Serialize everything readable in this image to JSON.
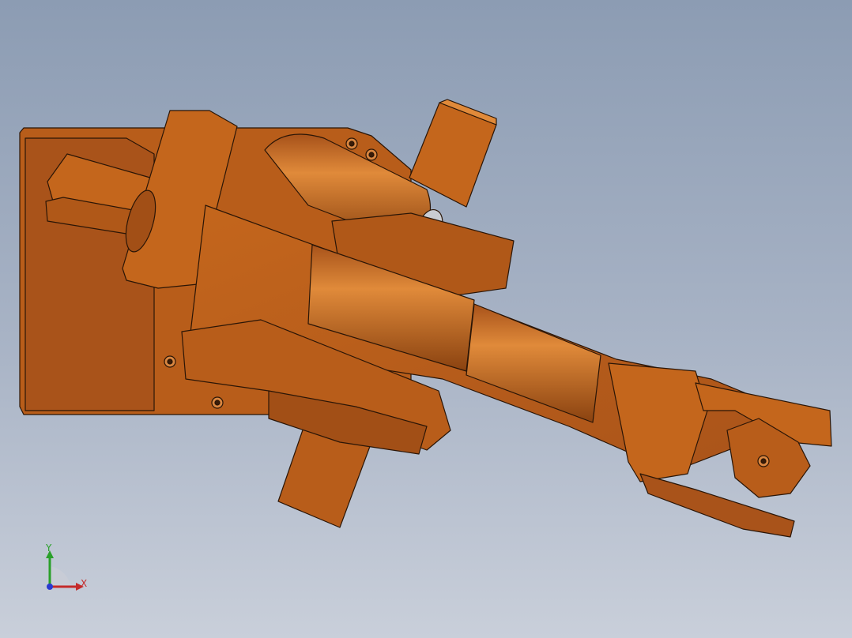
{
  "viewport": {
    "background_top": "#8c9cb3",
    "background_bottom": "#c9cfda"
  },
  "model": {
    "subject": "robot-arm-assembly",
    "body_color": "#c4661c",
    "edge_color": "#2a1506",
    "highlight_color": "#e08a3a",
    "shadow_color": "#8a4210"
  },
  "triad": {
    "x_label": "X",
    "y_label": "Y",
    "x_color": "#c42a2a",
    "y_color": "#2aa02a",
    "z_color": "#2a3ad0"
  }
}
